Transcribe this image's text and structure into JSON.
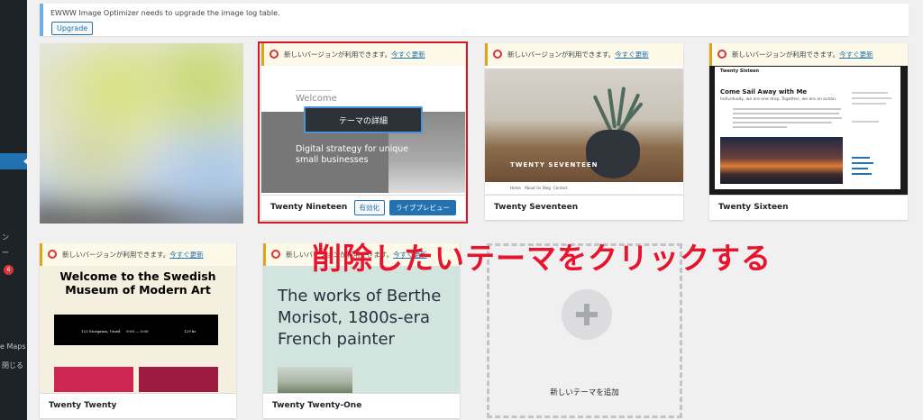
{
  "sidebar": {
    "badge_count": "6",
    "items": [
      {
        "label": "ン"
      },
      {
        "label": "ー"
      },
      {
        "label": "e Maps"
      },
      {
        "label": "閉じる"
      }
    ]
  },
  "notice": {
    "text": "EWWW Image Optimizer needs to upgrade the image log table.",
    "button_label": "Upgrade"
  },
  "update_notice": {
    "text": "新しいバージョンが利用できます。",
    "link": "今すぐ更新"
  },
  "themes": [
    {
      "name": ""
    },
    {
      "name": "Twenty Nineteen",
      "details_label": "テーマの詳細",
      "activate_label": "有効化",
      "preview_label": "ライブプレビュー",
      "screenshot": {
        "welcome": "Welcome",
        "tagline": "Digital strategy for unique small businesses"
      }
    },
    {
      "name": "Twenty Seventeen",
      "screenshot": {
        "overlay_title": "TWENTY SEVENTEEN",
        "nav": [
          "Home",
          "About Us",
          "Blog",
          "Contact"
        ]
      }
    },
    {
      "name": "Twenty Sixteen",
      "screenshot": {
        "site_title": "Twenty Sixteen",
        "post_title": "Come Sail Away with Me",
        "post_sub": "Individually, we are one drop. Together, we are an ocean."
      }
    },
    {
      "name": "Twenty Twenty",
      "screenshot": {
        "headline": "Welcome to the Swedish Museum of Modern Art",
        "address": "123 Storgatan, Umeå",
        "hours": "9:00 — 5:00",
        "price": "129 kr"
      }
    },
    {
      "name": "Twenty Twenty-One",
      "screenshot": {
        "headline": "The works of Berthe Morisot, 1800s-era French painter"
      }
    }
  ],
  "add_new": {
    "label": "新しいテーマを追加"
  },
  "annotation": "削除したいテーマをクリックする",
  "colors": {
    "accent": "#2271b1",
    "highlight_border": "#d11a2a",
    "annotation": "#e8132d",
    "update_border": "#dba617"
  }
}
